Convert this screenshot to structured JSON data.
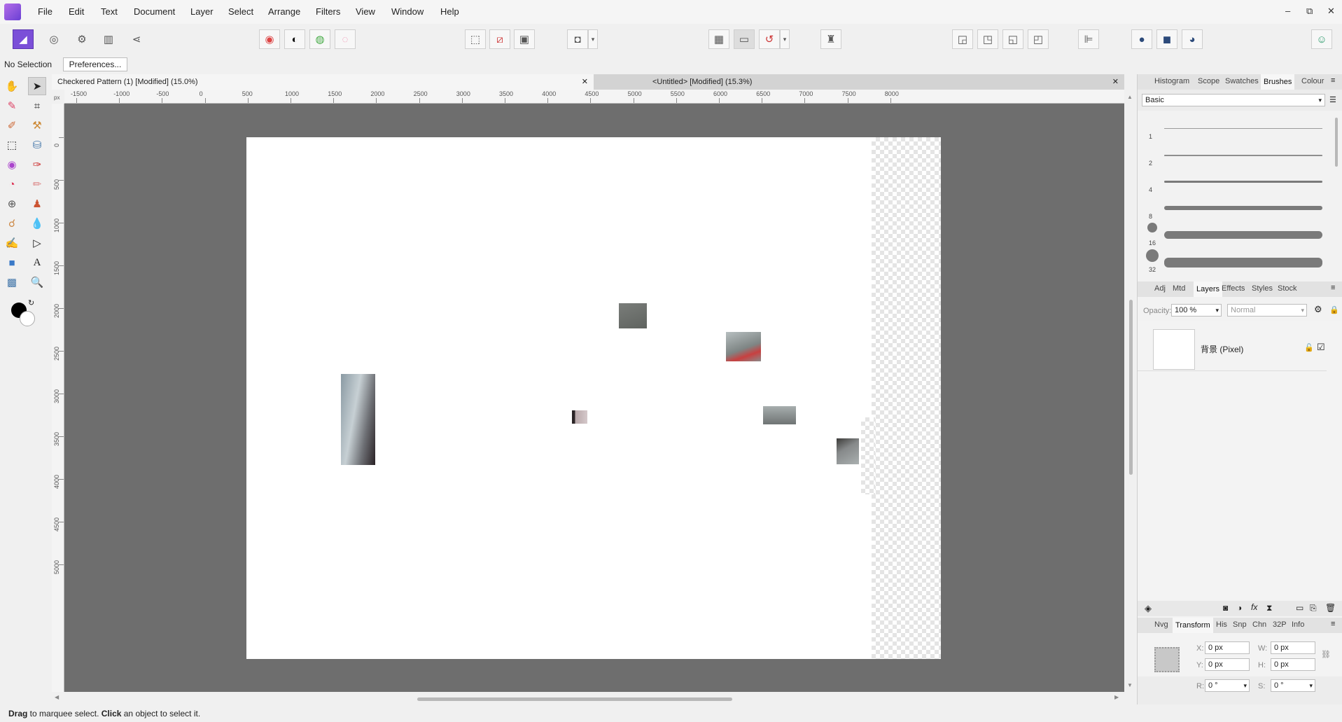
{
  "menu": {
    "items": [
      "File",
      "Edit",
      "Text",
      "Document",
      "Layer",
      "Select",
      "Arrange",
      "Filters",
      "View",
      "Window",
      "Help"
    ]
  },
  "window": {
    "minimize": "–",
    "restore": "⧉",
    "close": "✕"
  },
  "context": {
    "selection_status": "No Selection",
    "preferences_label": "Preferences..."
  },
  "tabs": [
    {
      "label": "Checkered Pattern (1) [Modified] (15.0%)",
      "close": "✕"
    },
    {
      "label": "<Untitled> [Modified] (15.3%)",
      "close": "✕"
    }
  ],
  "rulers": {
    "horizontal": [
      "-1500",
      "-1000",
      "-500",
      "0",
      "500",
      "1000",
      "1500",
      "2000",
      "2500",
      "3000",
      "3500",
      "4000",
      "4500",
      "5000",
      "5500",
      "6000",
      "6500",
      "7000",
      "7500",
      "8000"
    ],
    "vertical": [
      "0",
      "500",
      "1000",
      "1500",
      "2000",
      "2500",
      "3000",
      "3500",
      "4000",
      "4500",
      "5000"
    ],
    "unit": "px"
  },
  "brushes_panel": {
    "tabs": [
      "Histogram",
      "Scope",
      "Swatches",
      "Brushes",
      "Colour"
    ],
    "active_tab": "Brushes",
    "category": "Basic",
    "sizes": [
      "1",
      "2",
      "4",
      "8",
      "16",
      "32"
    ]
  },
  "layers_panel": {
    "tabs": [
      "Adj",
      "Mtd",
      "Layers",
      "Effects",
      "Styles",
      "Stock"
    ],
    "active_tab": "Layers",
    "opacity_label": "Opacity:",
    "opacity_value": "100 %",
    "blend_mode": "Normal",
    "layers": [
      {
        "name": "背景 (Pixel)"
      }
    ]
  },
  "transform_panel": {
    "tabs": [
      "Nvg",
      "Transform",
      "His",
      "Snp",
      "Chn",
      "32P",
      "Info"
    ],
    "active_tab": "Transform",
    "x_label": "X:",
    "x_value": "0 px",
    "y_label": "Y:",
    "y_value": "0 px",
    "w_label": "W:",
    "w_value": "0 px",
    "h_label": "H:",
    "h_value": "0 px",
    "r_label": "R:",
    "r_value": "0 °",
    "s_label": "S:",
    "s_value": "0 °"
  },
  "status": {
    "b1": "Drag",
    "t1": " to marquee select. ",
    "b2": "Click",
    "t2": " an object to select it."
  },
  "colors": {
    "accent": "#7b4fd8",
    "canvas_bg": "#6e6e6e",
    "panel_bg": "#ececec"
  }
}
